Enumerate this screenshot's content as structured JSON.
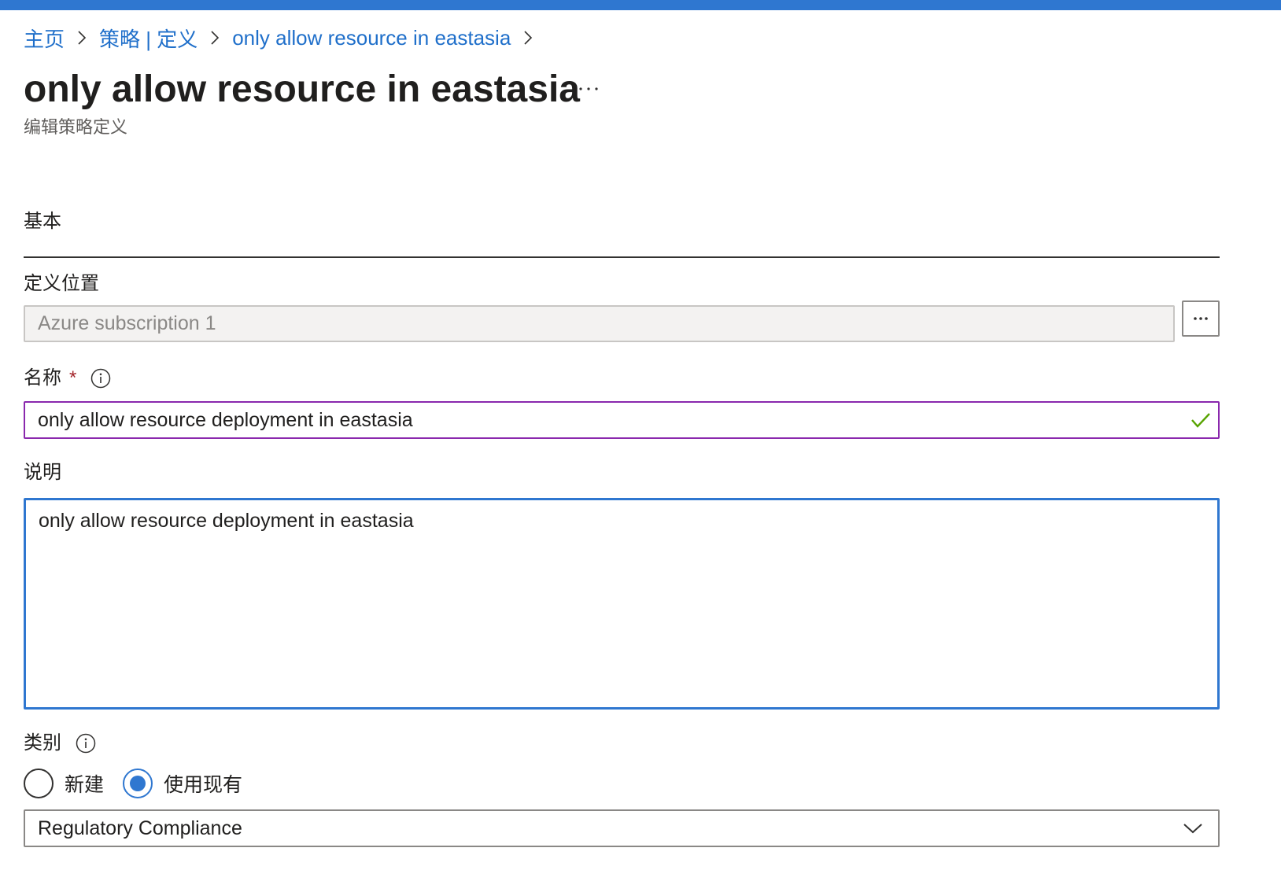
{
  "breadcrumb": {
    "items": [
      "主页",
      "策略 | 定义",
      "only allow resource in eastasia"
    ]
  },
  "header": {
    "title": "only allow resource in eastasia",
    "subtitle": "编辑策略定义"
  },
  "tabs": {
    "basics": "基本"
  },
  "form": {
    "scope": {
      "label": "定义位置",
      "value": "Azure subscription 1"
    },
    "name": {
      "label": "名称",
      "required_mark": "*",
      "value": "only allow resource deployment in eastasia"
    },
    "description": {
      "label": "说明",
      "value": "only allow resource deployment in eastasia"
    },
    "category": {
      "label": "类别",
      "options": [
        "新建",
        "使用现有"
      ],
      "selected_option": "使用现有",
      "value": "Regulatory Compliance"
    }
  },
  "icons": {
    "breadcrumb_separator": "chevron-right-icon",
    "more": "more-horizontal-icon",
    "info": "info-icon",
    "valid": "checkmark-icon",
    "dropdown": "chevron-down-icon"
  },
  "colors": {
    "accent": "#2f77d0",
    "link": "#1f6fca",
    "focus_border_name": "#8a28ad",
    "valid_check": "#57a300",
    "required": "#a4262c"
  }
}
